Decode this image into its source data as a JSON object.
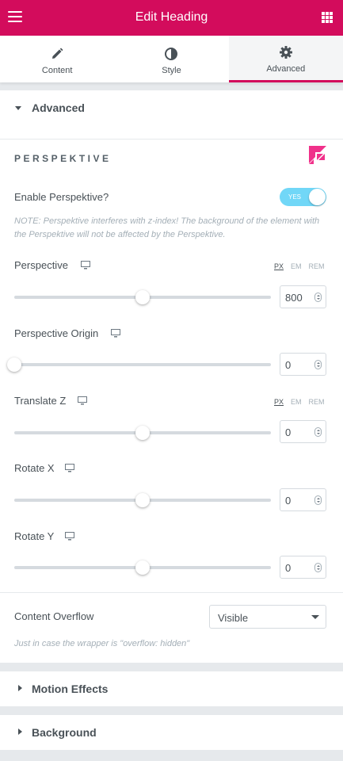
{
  "header": {
    "title": "Edit Heading",
    "menu_icon": "hamburger-icon",
    "apps_icon": "grid-icon"
  },
  "tabs": [
    {
      "label": "Content",
      "icon": "pencil-icon",
      "active": false
    },
    {
      "label": "Style",
      "icon": "half-circle-icon",
      "active": false
    },
    {
      "label": "Advanced",
      "icon": "gear-icon",
      "active": true
    }
  ],
  "sections": {
    "advanced": "Advanced",
    "motion_effects": "Motion Effects",
    "background": "Background"
  },
  "perspektive": {
    "title": "PERSPEKTIVE",
    "enable_label": "Enable Perspektive?",
    "toggle_text": "YES",
    "toggle_on": true,
    "note": "NOTE: Perspektive interferes with z-index! The background of the element with the Perspektive will not be affected by the Perspektive."
  },
  "units": {
    "px": "PX",
    "em": "EM",
    "rem": "REM"
  },
  "controls": [
    {
      "label": "Perspective",
      "value": "800",
      "fill": 0.5,
      "units": true
    },
    {
      "label": "Perspective Origin",
      "value": "0",
      "fill": 0.0,
      "units": false
    },
    {
      "label": "Translate Z",
      "value": "0",
      "fill": 0.5,
      "units": true
    },
    {
      "label": "Rotate X",
      "value": "0",
      "fill": 0.5,
      "units": false
    },
    {
      "label": "Rotate Y",
      "value": "0",
      "fill": 0.5,
      "units": false
    }
  ],
  "overflow": {
    "label": "Content Overflow",
    "selected": "Visible",
    "note": "Just in case the wrapper is \"overflow: hidden\""
  },
  "colors": {
    "brand": "#d30c5c",
    "toggle": "#71d7f7",
    "logo": "#f0318a"
  }
}
